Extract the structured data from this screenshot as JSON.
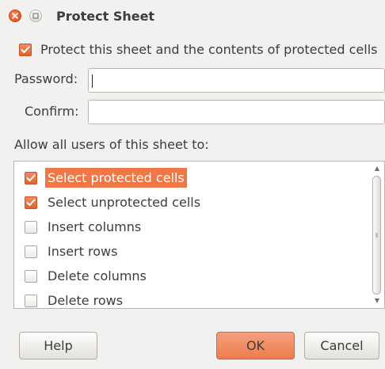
{
  "window": {
    "title": "Protect Sheet",
    "close_icon": "close-icon",
    "maximize_icon": "maximize-icon"
  },
  "protect": {
    "label": "Protect this sheet and the contents of protected cells",
    "checked": true
  },
  "password": {
    "label": "Password:",
    "value": ""
  },
  "confirm": {
    "label": "Confirm:",
    "value": ""
  },
  "allow": {
    "heading": "Allow all users of this sheet to:",
    "items": [
      {
        "label": "Select protected cells",
        "checked": true,
        "selected": true
      },
      {
        "label": "Select unprotected cells",
        "checked": true,
        "selected": false
      },
      {
        "label": "Insert columns",
        "checked": false,
        "selected": false
      },
      {
        "label": "Insert rows",
        "checked": false,
        "selected": false
      },
      {
        "label": "Delete columns",
        "checked": false,
        "selected": false
      },
      {
        "label": "Delete rows",
        "checked": false,
        "selected": false
      }
    ]
  },
  "buttons": {
    "help": "Help",
    "ok": "OK",
    "cancel": "Cancel"
  },
  "colors": {
    "accent": "#f07746",
    "check": "#e0622f"
  }
}
